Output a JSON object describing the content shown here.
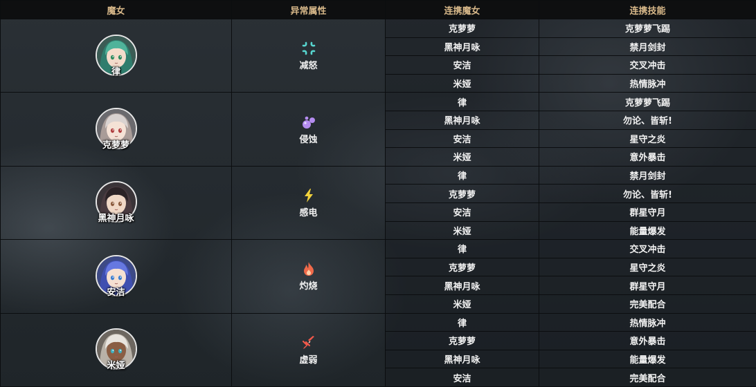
{
  "headers": {
    "witch": "魔女",
    "attribute": "异常属性",
    "partner": "连携魔女",
    "skill": "连携技能"
  },
  "colors": {
    "header_text": "#d9b98a",
    "header_bg": "#0e0f10"
  },
  "groups": [
    {
      "witch": "律",
      "avatar_icon": "green-hair-witch-avatar",
      "attribute": "减怒",
      "attribute_icon": "anger-mark-icon",
      "attribute_color": "#57d6d0",
      "rows": [
        {
          "partner": "克萝萝",
          "skill": "克萝萝飞踢"
        },
        {
          "partner": "黑神月咏",
          "skill": "禁月剑封"
        },
        {
          "partner": "安洁",
          "skill": "交叉冲击"
        },
        {
          "partner": "米娅",
          "skill": "热情脉冲"
        }
      ]
    },
    {
      "witch": "克萝萝",
      "avatar_icon": "white-hair-witch-avatar",
      "attribute": "侵蚀",
      "attribute_icon": "corrosion-bubbles-icon",
      "attribute_color": "#b48cf0",
      "rows": [
        {
          "partner": "律",
          "skill": "克萝萝飞踢"
        },
        {
          "partner": "黑神月咏",
          "skill": "勿论、皆斩!"
        },
        {
          "partner": "安洁",
          "skill": "星守之炎"
        },
        {
          "partner": "米娅",
          "skill": "意外暴击"
        }
      ]
    },
    {
      "witch": "黑神月咏",
      "avatar_icon": "dark-hair-witch-avatar",
      "attribute": "感电",
      "attribute_icon": "lightning-icon",
      "attribute_color": "#f2d23c",
      "rows": [
        {
          "partner": "律",
          "skill": "禁月剑封"
        },
        {
          "partner": "克萝萝",
          "skill": "勿论、皆斩!"
        },
        {
          "partner": "安洁",
          "skill": "群星守月"
        },
        {
          "partner": "米娅",
          "skill": "能量爆发"
        }
      ]
    },
    {
      "witch": "安洁",
      "avatar_icon": "blue-hair-witch-avatar",
      "attribute": "灼烧",
      "attribute_icon": "flame-icon",
      "attribute_color": "#f06a4a",
      "rows": [
        {
          "partner": "律",
          "skill": "交叉冲击"
        },
        {
          "partner": "克萝萝",
          "skill": "星守之炎"
        },
        {
          "partner": "黑神月咏",
          "skill": "群星守月"
        },
        {
          "partner": "米娅",
          "skill": "完美配合"
        }
      ]
    },
    {
      "witch": "米娅",
      "avatar_icon": "silver-hair-witch-avatar",
      "attribute": "虚弱",
      "attribute_icon": "broken-sword-icon",
      "attribute_color": "#f0584a",
      "rows": [
        {
          "partner": "律",
          "skill": "热情脉冲"
        },
        {
          "partner": "克萝萝",
          "skill": "意外暴击"
        },
        {
          "partner": "黑神月咏",
          "skill": "能量爆发"
        },
        {
          "partner": "安洁",
          "skill": "完美配合"
        }
      ]
    }
  ]
}
